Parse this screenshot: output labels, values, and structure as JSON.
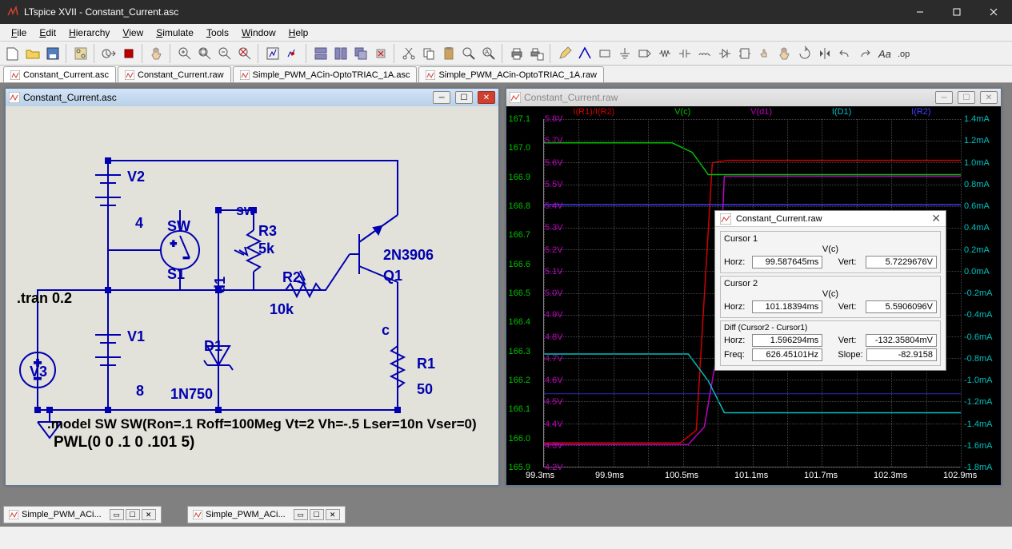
{
  "app": {
    "title": "LTspice XVII - Constant_Current.asc"
  },
  "menus": [
    "File",
    "Edit",
    "Hierarchy",
    "View",
    "Simulate",
    "Tools",
    "Window",
    "Help"
  ],
  "menu_letters": [
    "F",
    "E",
    "H",
    "V",
    "S",
    "T",
    "W",
    "H"
  ],
  "toolbar_icons": [
    "new",
    "open",
    "save",
    "sep",
    "pcb",
    "sep",
    "run",
    "stop",
    "sep",
    "hand",
    "sep",
    "zoom-in",
    "zoom-fit",
    "zoom-out",
    "zoom-undo",
    "sep",
    "autoscale",
    "mark",
    "sep",
    "tile-h",
    "tile-v",
    "cascade",
    "close-all",
    "sep",
    "cut",
    "copy",
    "paste",
    "find",
    "find2",
    "sep",
    "print",
    "print-setup",
    "sep",
    "pencil",
    "wire",
    "rect",
    "ground",
    "label",
    "res",
    "cap",
    "ind",
    "diode",
    "comp",
    "move",
    "drag",
    "rotate",
    "mirror",
    "undo",
    "redo",
    "text",
    "op"
  ],
  "tabs": [
    {
      "label": "Constant_Current.asc",
      "type": "asc"
    },
    {
      "label": "Constant_Current.raw",
      "type": "raw"
    },
    {
      "label": "Simple_PWM_ACin-OptoTRIAC_1A.asc",
      "type": "asc"
    },
    {
      "label": "Simple_PWM_ACin-OptoTRIAC_1A.raw",
      "type": "raw"
    }
  ],
  "childwins": {
    "schematic": {
      "title": "Constant_Current.asc"
    },
    "plot": {
      "title": "Constant_Current.raw"
    }
  },
  "schematic": {
    "tran": ".tran 0.2",
    "V2": {
      "name": "V2",
      "value": "4"
    },
    "V1": {
      "name": "V1",
      "value": "8"
    },
    "V3": {
      "name": "V3"
    },
    "SW": {
      "name": "SW",
      "ref": "S1",
      "net": "sw"
    },
    "R3": {
      "name": "R3",
      "value": "5k"
    },
    "R2": {
      "name": "R2",
      "value": "10k"
    },
    "R1": {
      "name": "R1",
      "value": "50"
    },
    "D1": {
      "name": "D1",
      "model": "1N750",
      "net": "d1"
    },
    "Q1": {
      "name": "Q1",
      "model": "2N3906",
      "net": "c"
    },
    "model_stmt": ".model SW SW(Ron=.1 Roff=100Meg Vt=2 Vh=-.5 Lser=10n Vser=0)",
    "pwl": "PWL(0 0 .1 0 .101 5)"
  },
  "plot": {
    "legend": [
      {
        "label": "I(R1)/I(R2)",
        "color": "#d00000"
      },
      {
        "label": "V(c)",
        "color": "#00c000"
      },
      {
        "label": "V(d1)",
        "color": "#c000c0"
      },
      {
        "label": "I(D1)",
        "color": "#00c0c0"
      },
      {
        "label": "I(R2)",
        "color": "#4040ff"
      }
    ],
    "yl_outer": [
      "167.1",
      "167.0",
      "166.9",
      "166.8",
      "166.7",
      "166.6",
      "166.5",
      "166.4",
      "166.3",
      "166.2",
      "166.1",
      "166.0",
      "165.9"
    ],
    "yl_inner": [
      "5.8V",
      "5.7V",
      "5.6V",
      "5.5V",
      "5.4V",
      "5.3V",
      "5.2V",
      "5.1V",
      "5.0V",
      "4.9V",
      "4.8V",
      "4.7V",
      "4.6V",
      "4.5V",
      "4.4V",
      "4.3V",
      "4.2V"
    ],
    "yr": [
      "1.4mA",
      "1.2mA",
      "1.0mA",
      "0.8mA",
      "0.6mA",
      "0.4mA",
      "0.2mA",
      "0.0mA",
      "-0.2mA",
      "-0.4mA",
      "-0.6mA",
      "-0.8mA",
      "-1.0mA",
      "-1.2mA",
      "-1.4mA",
      "-1.6mA",
      "-1.8mA"
    ],
    "xticks": [
      "99.3ms",
      "99.9ms",
      "100.5ms",
      "101.1ms",
      "101.7ms",
      "102.3ms",
      "102.9ms"
    ]
  },
  "cursor": {
    "title": "Constant_Current.raw",
    "c1_header": "Cursor 1",
    "c2_header": "Cursor 2",
    "diff_header": "Diff (Cursor2 - Cursor1)",
    "trace": "V(c)",
    "c1": {
      "horz": "99.587645ms",
      "vert": "5.7229676V"
    },
    "c2": {
      "horz": "101.18394ms",
      "vert": "5.5906096V"
    },
    "diff": {
      "horz": "1.596294ms",
      "vert": "-132.35804mV"
    },
    "freq": "626.45101Hz",
    "slope": "-82.9158",
    "labels": {
      "horz": "Horz:",
      "vert": "Vert:",
      "freq": "Freq:",
      "slope": "Slope:"
    }
  },
  "minimized": [
    {
      "label": "Simple_PWM_ACi..."
    },
    {
      "label": "Simple_PWM_ACi..."
    }
  ]
}
